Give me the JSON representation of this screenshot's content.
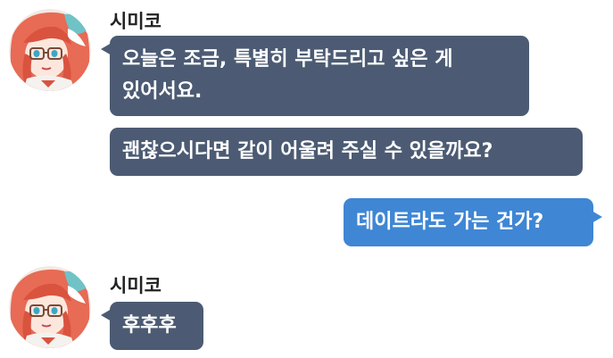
{
  "conversation": {
    "groups": [
      {
        "sender": "시미코",
        "avatar_icon": "character-avatar-icon",
        "messages": [
          {
            "line1": "오늘은 조금, 특별히 부탁드리고 싶은 게",
            "line2": "있어서요."
          },
          {
            "text": "괜찮으시다면 같이 어울려 주실 수 있을까요?"
          }
        ]
      },
      {
        "sender": "me",
        "messages": [
          {
            "text": "데이트라도 가는 건가?"
          }
        ]
      },
      {
        "sender": "시미코",
        "avatar_icon": "character-avatar-icon",
        "messages": [
          {
            "text": "후후후"
          }
        ]
      }
    ]
  },
  "colors": {
    "incoming_bubble": "#4c5b73",
    "outgoing_bubble": "#3f86d4",
    "bubble_text": "#ffffff",
    "sender_name": "#222222"
  }
}
